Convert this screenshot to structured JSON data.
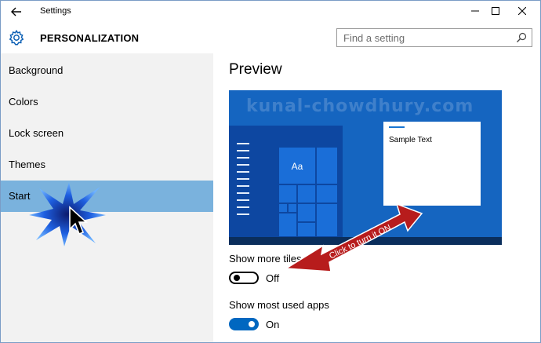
{
  "window": {
    "title": "Settings",
    "back_icon": "back-arrow-icon",
    "minimize_glyph": "—",
    "maximize_glyph": "☐",
    "close_glyph": "✕"
  },
  "header": {
    "icon": "gear-icon",
    "heading": "PERSONALIZATION",
    "search_placeholder": "Find a setting"
  },
  "sidebar": {
    "items": [
      {
        "label": "Background",
        "active": false
      },
      {
        "label": "Colors",
        "active": false
      },
      {
        "label": "Lock screen",
        "active": false
      },
      {
        "label": "Themes",
        "active": false
      },
      {
        "label": "Start",
        "active": true
      }
    ]
  },
  "content": {
    "title": "Preview",
    "preview": {
      "watermark": "kunal-chowdhury.com",
      "tile_label": "Aa",
      "sample_text": "Sample Text"
    },
    "settings": [
      {
        "label": "Show more tiles",
        "state": "Off",
        "on": false
      },
      {
        "label": "Show most used apps",
        "state": "On",
        "on": true
      }
    ]
  },
  "annotation": {
    "callout_text": "Click to turn it ON",
    "arrow_color": "#b71c1c"
  },
  "colors": {
    "accent": "#0067c0",
    "sidebar_selected": "#7ab2dd",
    "preview_bg": "#1565c0"
  }
}
